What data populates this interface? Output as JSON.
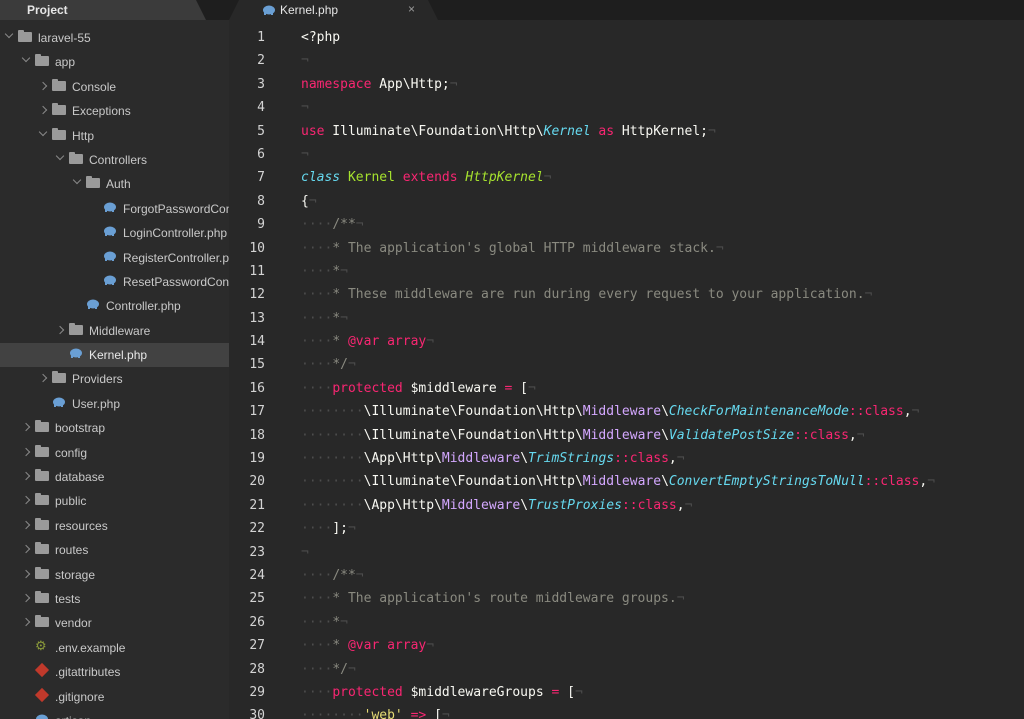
{
  "sidebar": {
    "tab_title": "Project",
    "tree": [
      {
        "label": "laravel-55",
        "kind": "folder",
        "depth": 0,
        "expand": "open"
      },
      {
        "label": "app",
        "kind": "folder",
        "depth": 1,
        "expand": "open"
      },
      {
        "label": "Console",
        "kind": "folder",
        "depth": 2,
        "expand": "closed"
      },
      {
        "label": "Exceptions",
        "kind": "folder",
        "depth": 2,
        "expand": "closed"
      },
      {
        "label": "Http",
        "kind": "folder",
        "depth": 2,
        "expand": "open"
      },
      {
        "label": "Controllers",
        "kind": "folder",
        "depth": 3,
        "expand": "open"
      },
      {
        "label": "Auth",
        "kind": "folder",
        "depth": 4,
        "expand": "open"
      },
      {
        "label": "ForgotPasswordController.php",
        "kind": "php",
        "depth": 5
      },
      {
        "label": "LoginController.php",
        "kind": "php",
        "depth": 5
      },
      {
        "label": "RegisterController.php",
        "kind": "php",
        "depth": 5
      },
      {
        "label": "ResetPasswordController.php",
        "kind": "php",
        "depth": 5
      },
      {
        "label": "Controller.php",
        "kind": "php",
        "depth": 4
      },
      {
        "label": "Middleware",
        "kind": "folder",
        "depth": 3,
        "expand": "closed"
      },
      {
        "label": "Kernel.php",
        "kind": "php",
        "depth": 3,
        "selected": true
      },
      {
        "label": "Providers",
        "kind": "folder",
        "depth": 2,
        "expand": "closed"
      },
      {
        "label": "User.php",
        "kind": "php",
        "depth": 2
      },
      {
        "label": "bootstrap",
        "kind": "folder",
        "depth": 1,
        "expand": "closed"
      },
      {
        "label": "config",
        "kind": "folder",
        "depth": 1,
        "expand": "closed"
      },
      {
        "label": "database",
        "kind": "folder",
        "depth": 1,
        "expand": "closed"
      },
      {
        "label": "public",
        "kind": "folder",
        "depth": 1,
        "expand": "closed"
      },
      {
        "label": "resources",
        "kind": "folder",
        "depth": 1,
        "expand": "closed"
      },
      {
        "label": "routes",
        "kind": "folder",
        "depth": 1,
        "expand": "closed"
      },
      {
        "label": "storage",
        "kind": "folder",
        "depth": 1,
        "expand": "closed"
      },
      {
        "label": "tests",
        "kind": "folder",
        "depth": 1,
        "expand": "closed"
      },
      {
        "label": "vendor",
        "kind": "folder",
        "depth": 1,
        "expand": "closed"
      },
      {
        "label": ".env.example",
        "kind": "gear",
        "depth": 1
      },
      {
        "label": ".gitattributes",
        "kind": "git",
        "depth": 1
      },
      {
        "label": ".gitignore",
        "kind": "git",
        "depth": 1
      },
      {
        "label": "artisan",
        "kind": "php",
        "depth": 1
      }
    ]
  },
  "editor": {
    "tab_title": "Kernel.php",
    "close_glyph": "×",
    "line_numbers": [
      "1",
      "2",
      "3",
      "4",
      "5",
      "6",
      "7",
      "8",
      "9",
      "10",
      "11",
      "12",
      "13",
      "14",
      "15",
      "16",
      "17",
      "18",
      "19",
      "20",
      "21",
      "22",
      "23",
      "24",
      "25",
      "26",
      "27",
      "28",
      "29",
      "30"
    ],
    "lines": [
      [
        [
          "pl",
          "<?php"
        ]
      ],
      [
        [
          "ws",
          "¬"
        ]
      ],
      [
        [
          "kw",
          "namespace"
        ],
        [
          "pl",
          " App\\Http;"
        ],
        [
          "ws",
          "¬"
        ]
      ],
      [
        [
          "ws",
          "¬"
        ]
      ],
      [
        [
          "kw",
          "use"
        ],
        [
          "pl",
          " Illuminate\\Foundation\\Http\\"
        ],
        [
          "it",
          "Kernel"
        ],
        [
          "kw",
          " as"
        ],
        [
          "pl",
          " HttpKernel;"
        ],
        [
          "ws",
          "¬"
        ]
      ],
      [
        [
          "ws",
          "¬"
        ]
      ],
      [
        [
          "it",
          "class"
        ],
        [
          "cn",
          " Kernel"
        ],
        [
          "kw",
          " extends"
        ],
        [
          "pl",
          " "
        ],
        [
          "cni",
          "HttpKernel"
        ],
        [
          "ws",
          "¬"
        ]
      ],
      [
        [
          "pl",
          "{"
        ],
        [
          "ws",
          "¬"
        ]
      ],
      [
        [
          "ws",
          "····"
        ],
        [
          "cm",
          "/**"
        ],
        [
          "ws",
          "¬"
        ]
      ],
      [
        [
          "ws",
          "····"
        ],
        [
          "cm",
          "* The application's global HTTP middleware stack."
        ],
        [
          "ws",
          "¬"
        ]
      ],
      [
        [
          "ws",
          "····"
        ],
        [
          "cm",
          "*"
        ],
        [
          "ws",
          "¬"
        ]
      ],
      [
        [
          "ws",
          "····"
        ],
        [
          "cm",
          "* These middleware are run during every request to your application."
        ],
        [
          "ws",
          "¬"
        ]
      ],
      [
        [
          "ws",
          "····"
        ],
        [
          "cm",
          "*"
        ],
        [
          "ws",
          "¬"
        ]
      ],
      [
        [
          "ws",
          "····"
        ],
        [
          "cm",
          "* "
        ],
        [
          "kw",
          "@var"
        ],
        [
          "pl",
          " "
        ],
        [
          "kw",
          "array"
        ],
        [
          "ws",
          "¬"
        ]
      ],
      [
        [
          "ws",
          "····"
        ],
        [
          "cm",
          "*/"
        ],
        [
          "ws",
          "¬"
        ]
      ],
      [
        [
          "ws",
          "····"
        ],
        [
          "kw",
          "protected"
        ],
        [
          "pl",
          " $middleware "
        ],
        [
          "kw",
          "="
        ],
        [
          "pl",
          " ["
        ],
        [
          "ws",
          "¬"
        ]
      ],
      [
        [
          "ws",
          "········"
        ],
        [
          "pl",
          "\\Illuminate\\Foundation\\Http\\"
        ],
        [
          "ns",
          "Middleware"
        ],
        [
          "pl",
          "\\"
        ],
        [
          "it",
          "CheckForMaintenanceMode"
        ],
        [
          "kw",
          "::class"
        ],
        [
          "pl",
          ","
        ],
        [
          "ws",
          "¬"
        ]
      ],
      [
        [
          "ws",
          "········"
        ],
        [
          "pl",
          "\\Illuminate\\Foundation\\Http\\"
        ],
        [
          "ns",
          "Middleware"
        ],
        [
          "pl",
          "\\"
        ],
        [
          "it",
          "ValidatePostSize"
        ],
        [
          "kw",
          "::class"
        ],
        [
          "pl",
          ","
        ],
        [
          "ws",
          "¬"
        ]
      ],
      [
        [
          "ws",
          "········"
        ],
        [
          "pl",
          "\\App\\Http\\"
        ],
        [
          "ns",
          "Middleware"
        ],
        [
          "pl",
          "\\"
        ],
        [
          "it",
          "TrimStrings"
        ],
        [
          "kw",
          "::class"
        ],
        [
          "pl",
          ","
        ],
        [
          "ws",
          "¬"
        ]
      ],
      [
        [
          "ws",
          "········"
        ],
        [
          "pl",
          "\\Illuminate\\Foundation\\Http\\"
        ],
        [
          "ns",
          "Middleware"
        ],
        [
          "pl",
          "\\"
        ],
        [
          "it",
          "ConvertEmptyStringsToNull"
        ],
        [
          "kw",
          "::class"
        ],
        [
          "pl",
          ","
        ],
        [
          "ws",
          "¬"
        ]
      ],
      [
        [
          "ws",
          "········"
        ],
        [
          "pl",
          "\\App\\Http\\"
        ],
        [
          "ns",
          "Middleware"
        ],
        [
          "pl",
          "\\"
        ],
        [
          "it",
          "TrustProxies"
        ],
        [
          "kw",
          "::class"
        ],
        [
          "pl",
          ","
        ],
        [
          "ws",
          "¬"
        ]
      ],
      [
        [
          "ws",
          "····"
        ],
        [
          "pl",
          "];"
        ],
        [
          "ws",
          "¬"
        ]
      ],
      [
        [
          "ws",
          "¬"
        ]
      ],
      [
        [
          "ws",
          "····"
        ],
        [
          "cm",
          "/**"
        ],
        [
          "ws",
          "¬"
        ]
      ],
      [
        [
          "ws",
          "····"
        ],
        [
          "cm",
          "* The application's route middleware groups."
        ],
        [
          "ws",
          "¬"
        ]
      ],
      [
        [
          "ws",
          "····"
        ],
        [
          "cm",
          "*"
        ],
        [
          "ws",
          "¬"
        ]
      ],
      [
        [
          "ws",
          "····"
        ],
        [
          "cm",
          "* "
        ],
        [
          "kw",
          "@var"
        ],
        [
          "pl",
          " "
        ],
        [
          "kw",
          "array"
        ],
        [
          "ws",
          "¬"
        ]
      ],
      [
        [
          "ws",
          "····"
        ],
        [
          "cm",
          "*/"
        ],
        [
          "ws",
          "¬"
        ]
      ],
      [
        [
          "ws",
          "····"
        ],
        [
          "kw",
          "protected"
        ],
        [
          "pl",
          " $middlewareGroups "
        ],
        [
          "kw",
          "="
        ],
        [
          "pl",
          " ["
        ],
        [
          "ws",
          "¬"
        ]
      ],
      [
        [
          "ws",
          "········"
        ],
        [
          "st",
          "'web'"
        ],
        [
          "pl",
          " "
        ],
        [
          "kw",
          "=>"
        ],
        [
          "pl",
          " ["
        ],
        [
          "ws",
          "¬"
        ]
      ]
    ]
  },
  "colors": {
    "sidebar_bg": "#2b2b2b",
    "editor_bg": "#282828",
    "selection_bg": "#424242",
    "keyword": "#f92672",
    "type_italic": "#66d9ef",
    "class_name": "#a6e22e",
    "comment": "#8a8a80",
    "namespace": "#d4a8ff",
    "string": "#e6db74"
  }
}
